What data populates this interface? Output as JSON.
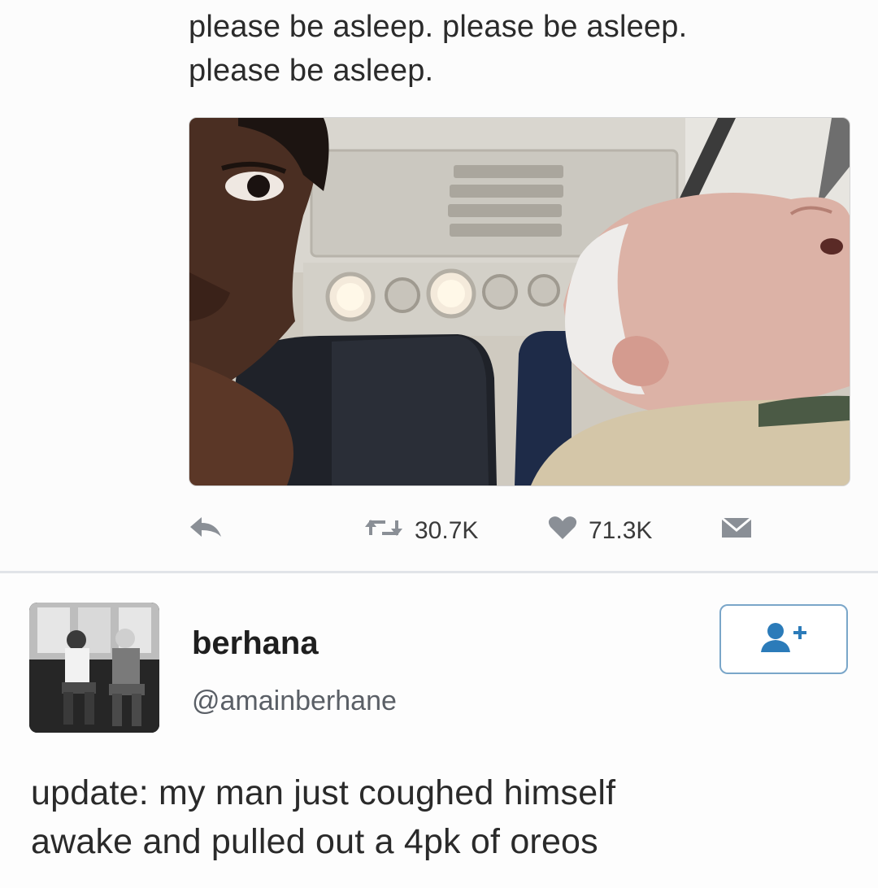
{
  "first_tweet": {
    "text_line1": "please be asleep. please be asleep.",
    "text_line2": "please be asleep.",
    "actions": {
      "reply_icon": "reply-icon",
      "retweet_icon": "retweet-icon",
      "retweet_count": "30.7K",
      "like_icon": "heart-icon",
      "like_count": "71.3K",
      "dm_icon": "direct-message-icon"
    },
    "colors": {
      "action_gray": "#8a8f96"
    }
  },
  "second_tweet": {
    "display_name": "berhana",
    "handle": "@amainberhane",
    "follow_icon": "add-user-icon",
    "text_line1": "update: my man just coughed himself",
    "text_line2": "awake and pulled out a 4pk of oreos",
    "colors": {
      "follow_accent": "#2b7bb9"
    }
  }
}
